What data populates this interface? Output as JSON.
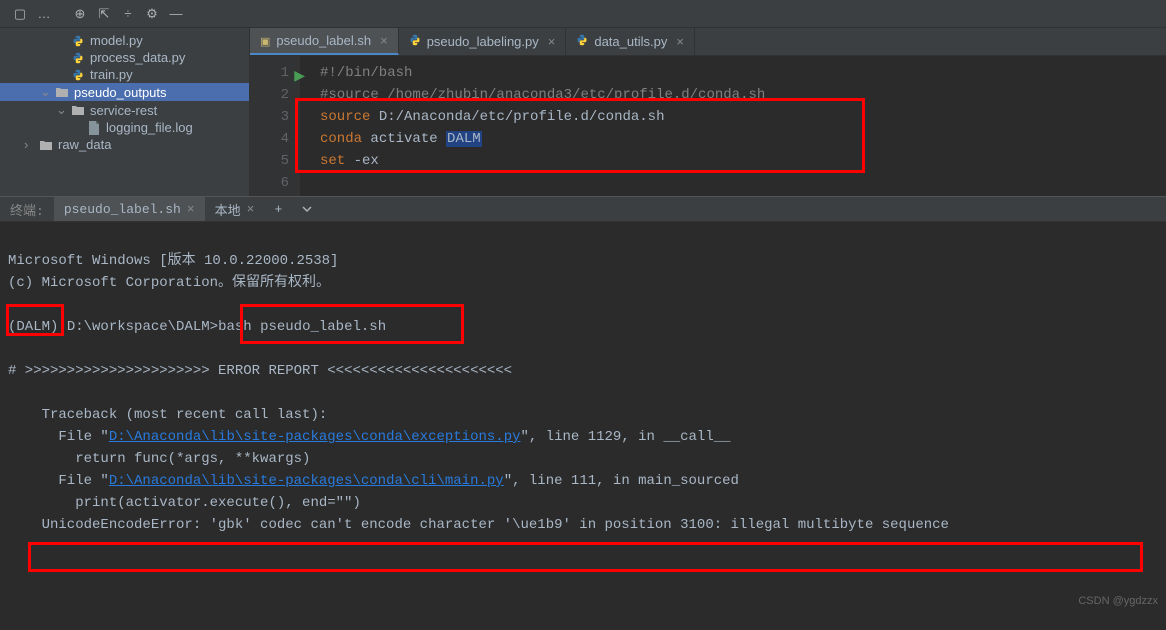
{
  "toolbar": {},
  "tree": {
    "items": [
      {
        "label": "model.py",
        "type": "py",
        "indent": 3,
        "chevron": ""
      },
      {
        "label": "process_data.py",
        "type": "py",
        "indent": 3,
        "chevron": ""
      },
      {
        "label": "train.py",
        "type": "py",
        "indent": 3,
        "chevron": ""
      },
      {
        "label": "pseudo_outputs",
        "type": "folder",
        "indent": 2,
        "chevron": "v",
        "selected": true
      },
      {
        "label": "service-rest",
        "type": "folder",
        "indent": 3,
        "chevron": "v"
      },
      {
        "label": "logging_file.log",
        "type": "file",
        "indent": 4,
        "chevron": ""
      },
      {
        "label": "raw_data",
        "type": "folder",
        "indent": 1,
        "chevron": ">"
      }
    ]
  },
  "tabs": [
    {
      "label": "pseudo_label.sh",
      "type": "sh",
      "active": true
    },
    {
      "label": "pseudo_labeling.py",
      "type": "py",
      "active": false
    },
    {
      "label": "data_utils.py",
      "type": "py",
      "active": false
    }
  ],
  "code": {
    "lines": [
      {
        "n": "1",
        "html": "<span class='cmt'>#!/bin/bash</span>"
      },
      {
        "n": "2",
        "html": "<span class='cmt'>#source /home/zhubin/anaconda3/etc/profile.d/conda.sh</span>"
      },
      {
        "n": "3",
        "html": "<span class='kw1'>source</span> <span class='str'>D:/Anaconda/etc/profile.d/conda.sh</span>"
      },
      {
        "n": "4",
        "html": "<span class='kw1'>conda</span> <span class='str'>activate </span><span class='highlight-bg'>DALM</span>"
      },
      {
        "n": "5",
        "html": "<span class='kw1'>set</span> <span class='opt'>-ex</span>"
      },
      {
        "n": "6",
        "html": ""
      }
    ]
  },
  "terminal": {
    "tabLabel1": "终端:",
    "tabs": [
      {
        "label": "pseudo_label.sh",
        "active": true
      },
      {
        "label": "本地",
        "active": false
      }
    ],
    "lines": {
      "l1": "Microsoft Windows [版本 10.0.22000.2538]",
      "l2": "(c) Microsoft Corporation。保留所有权利。",
      "l3": "",
      "l4_env": "(DALM)",
      "l4_path": "D:\\workspace\\DALM>",
      "l4_cmd": "bash pseudo_label.sh",
      "l5": "",
      "l6": "# >>>>>>>>>>>>>>>>>>>>>> ERROR REPORT <<<<<<<<<<<<<<<<<<<<<<",
      "l7": "",
      "l8": "    Traceback (most recent call last):",
      "l9a": "      File \"",
      "l9link": "D:\\Anaconda\\lib\\site-packages\\conda\\exceptions.py",
      "l9b": "\", line 1129, in __call__",
      "l10": "        return func(*args, **kwargs)",
      "l11a": "      File \"",
      "l11link": "D:\\Anaconda\\lib\\site-packages\\conda\\cli\\main.py",
      "l11b": "\", line 111, in main_sourced",
      "l12": "        print(activator.execute(), end=\"\")",
      "l13": "    UnicodeEncodeError: 'gbk' codec can't encode character '\\ue1b9' in position 3100: illegal multibyte sequence"
    }
  },
  "watermark": "CSDN @ygdzzx"
}
